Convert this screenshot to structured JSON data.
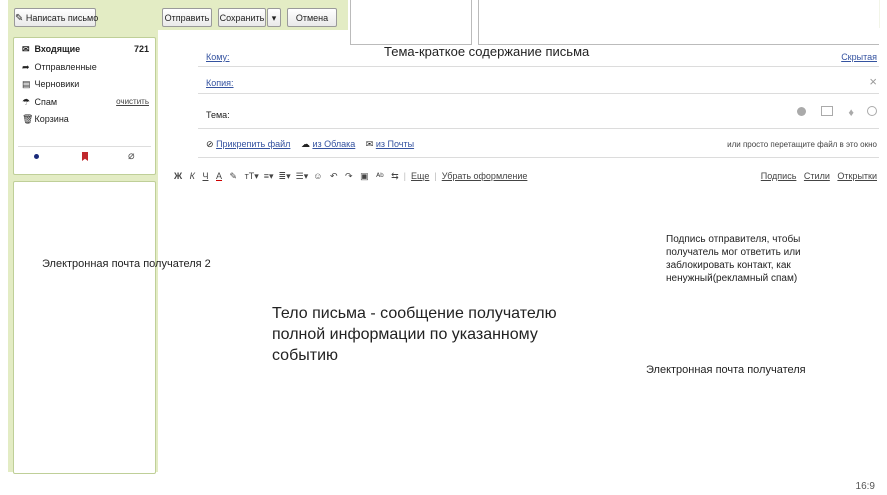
{
  "toolbar": {
    "compose_label": "Написать письмо",
    "send_label": "Отправить",
    "save_label": "Сохранить",
    "dropdown_glyph": "▾",
    "cancel_label": "Отмена"
  },
  "folders": [
    {
      "icon": "inbox-icon",
      "glyph": "✉",
      "label": "Входящие",
      "count": "721"
    },
    {
      "icon": "sent-icon",
      "glyph": "➦",
      "label": "Отправленные",
      "count": ""
    },
    {
      "icon": "drafts-icon",
      "glyph": "▤",
      "label": "Черновики",
      "count": ""
    },
    {
      "icon": "spam-icon",
      "glyph": "☂",
      "label": "Спам",
      "action": "очистить"
    },
    {
      "icon": "trash-icon",
      "glyph": "🗑",
      "label": "Корзина",
      "count": ""
    }
  ],
  "filter_icons": [
    "dot-icon",
    "bookmark-icon",
    "paperclip-icon"
  ],
  "compose": {
    "to_label": "Кому:",
    "cc_label": "Копия:",
    "subject_label": "Тема:",
    "hidden_link": "Скрытая",
    "close_glyph": "×",
    "attach_file": "Прикрепить файл",
    "from_cloud": "из Облака",
    "from_mail": "из Почты",
    "drag_hint": "или просто перетащите файл в это окно"
  },
  "format_toolbar": {
    "more": "Еще",
    "clear_format": "Убрать оформление",
    "signature": "Подпись",
    "styles": "Стили",
    "cards": "Открытки"
  },
  "annotations": {
    "subject_note": "Тема-краткое содержание письма",
    "recipient2_note": "Электронная почта получателя 2",
    "body_note": "Тело письма - сообщение получателю полной информации по указанному событию",
    "signature_note": "Подпись отправителя, чтобы получатель мог ответить или заблокировать контакт, как ненужный(рекламный спам)",
    "recipient_note": "Электронная почта получателя"
  },
  "slide_ratio": "16:9",
  "colors": {
    "accent_green": "#e3ecc4",
    "panel_border": "#bfcf98",
    "link_blue": "#3553a0"
  }
}
